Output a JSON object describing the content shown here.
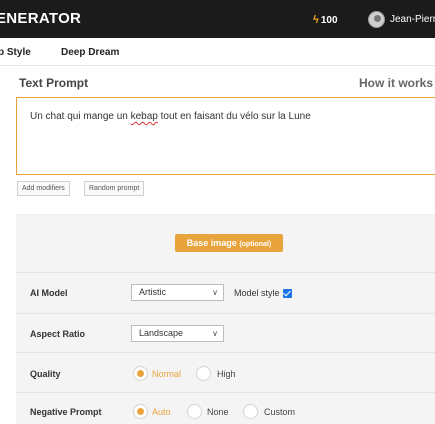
{
  "header": {
    "brand": "ENERATOR",
    "credits": "100",
    "username": "Jean-Pierre"
  },
  "subnav": {
    "items": [
      "p Style",
      "Deep Dream"
    ]
  },
  "prompt": {
    "title": "Text Prompt",
    "how_it_works": "How it works",
    "text_before": "Un chat qui mange un ",
    "text_misspelled": "kebap",
    "text_after": " tout en faisant du vélo sur la Lune",
    "add_modifiers": "Add modifiers",
    "random_prompt": "Random prompt"
  },
  "options": {
    "base_image_label": "Base image",
    "base_image_optional": "(optional)",
    "ai_model": {
      "label": "AI Model",
      "value": "Artistic",
      "model_style_label": "Model style",
      "model_style_checked": true
    },
    "aspect_ratio": {
      "label": "Aspect Ratio",
      "value": "Landscape"
    },
    "quality": {
      "label": "Quality",
      "options": [
        "Normal",
        "High"
      ],
      "selected": "Normal"
    },
    "negative_prompt": {
      "label": "Negative Prompt",
      "options": [
        "Auto",
        "None",
        "Custom"
      ],
      "selected": "Auto"
    }
  },
  "colors": {
    "accent": "#e8a33c",
    "topbar": "#1b1b1b",
    "checkbox": "#1a73e8"
  }
}
